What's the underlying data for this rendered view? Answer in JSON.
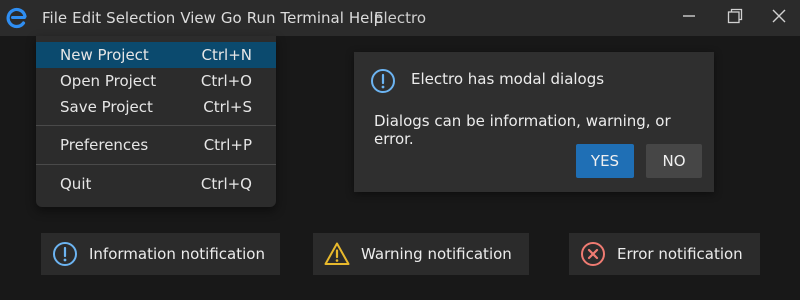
{
  "app": {
    "title": "Electro",
    "logo_icon": "electro-logo-icon"
  },
  "menubar": [
    "File",
    "Edit",
    "Selection",
    "View",
    "Go",
    "Run",
    "Terminal",
    "Help"
  ],
  "window_controls": [
    "minimize-icon",
    "maximize-icon",
    "close-icon"
  ],
  "file_menu": {
    "items": [
      {
        "label": "New Project",
        "shortcut": "Ctrl+N"
      },
      {
        "label": "Open Project",
        "shortcut": "Ctrl+O"
      },
      {
        "label": "Save Project",
        "shortcut": "Ctrl+S"
      },
      {
        "label": "Preferences",
        "shortcut": "Ctrl+P"
      },
      {
        "label": "Quit",
        "shortcut": "Ctrl+Q"
      }
    ]
  },
  "modal": {
    "icon": "info-icon",
    "title": "Electro has modal dialogs",
    "message": "Dialogs can be information, warning, or error.",
    "yes_label": "YES",
    "no_label": "NO"
  },
  "notifications": {
    "info": {
      "label": "Information notification",
      "icon": "info-icon",
      "color": "#6cb4f2"
    },
    "warning": {
      "label": "Warning notification",
      "icon": "warning-icon",
      "color": "#e8b92c"
    },
    "error": {
      "label": "Error notification",
      "icon": "error-icon",
      "color": "#ef7b72"
    }
  },
  "colors": {
    "accent": "#1f6fb5",
    "menu_selection": "#0b4a6e",
    "logo": "#2f8ef2"
  }
}
